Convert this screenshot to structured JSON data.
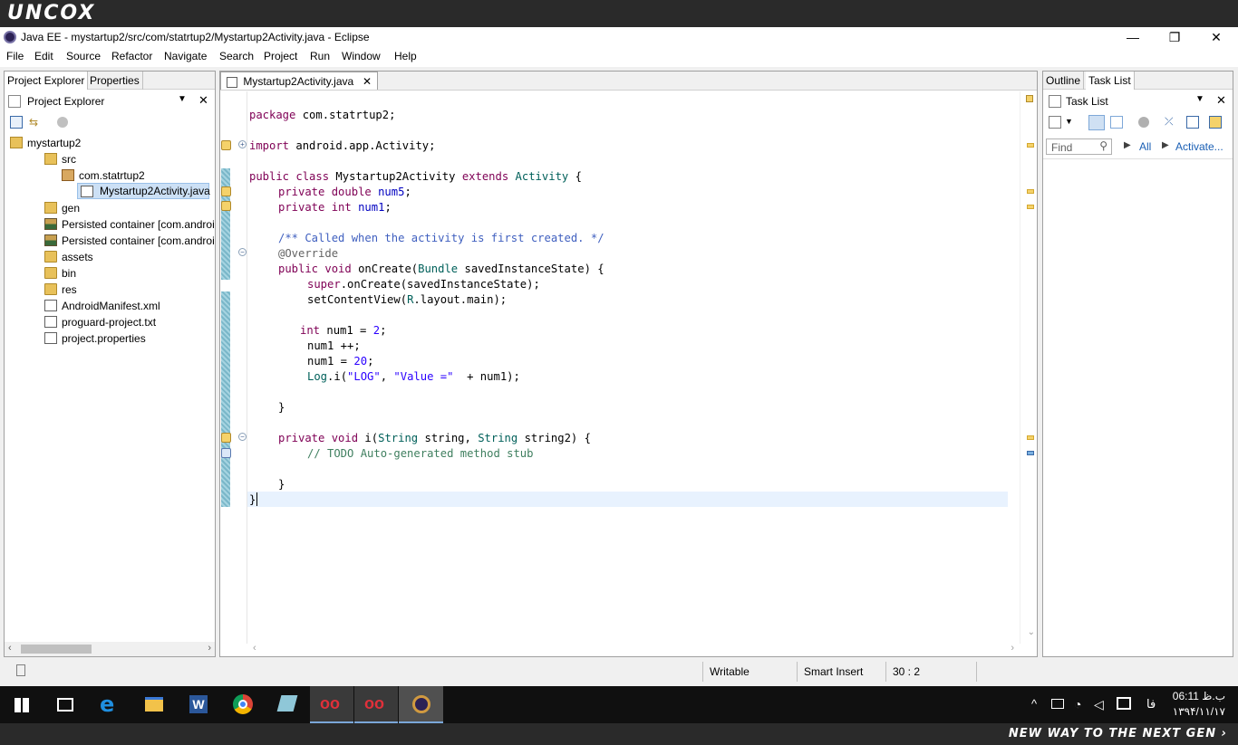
{
  "brand": {
    "top_logo": "UNCOX",
    "bottom_tagline": "NEW WAY TO THE NEXT GEN ›"
  },
  "window": {
    "title": "Java EE - mystartup2/src/com/statrtup2/Mystartup2Activity.java - Eclipse",
    "controls": {
      "minimize": "—",
      "maximize": "❐",
      "close": "✕"
    }
  },
  "menu": [
    "File",
    "Edit",
    "Source",
    "Refactor",
    "Navigate",
    "Search",
    "Project",
    "Run",
    "Window",
    "Help"
  ],
  "left_panel": {
    "tabs": [
      "Project Explorer",
      "Properties"
    ],
    "view_title": "Project Explorer",
    "tree": [
      {
        "label": "mystartup2"
      },
      {
        "label": "src"
      },
      {
        "label": "com.statrtup2"
      },
      {
        "label": "Mystartup2Activity.java"
      },
      {
        "label": "gen"
      },
      {
        "label": "Persisted container [com.androi"
      },
      {
        "label": "Persisted container [com.androi"
      },
      {
        "label": "assets"
      },
      {
        "label": "bin"
      },
      {
        "label": "res"
      },
      {
        "label": "AndroidManifest.xml"
      },
      {
        "label": "proguard-project.txt"
      },
      {
        "label": "project.properties"
      }
    ]
  },
  "editor": {
    "tab_label": "Mystartup2Activity.java",
    "close_glyph": "✕",
    "lines": [
      {
        "t": [
          [
            "kw",
            "package"
          ],
          [
            "",
            "com.statrtup2;"
          ]
        ]
      },
      {
        "t": [
          [
            "kw",
            "import"
          ],
          [
            "",
            "android.app.Activity;"
          ]
        ]
      },
      {
        "t": [
          [
            "kw",
            "public"
          ],
          [
            "",
            ""
          ],
          [
            "kw",
            "class"
          ],
          [
            "",
            "Mystartup2Activity"
          ],
          [
            "kw",
            "extends"
          ],
          [
            "ty",
            "Activity"
          ],
          [
            "",
            "{"
          ]
        ]
      },
      {
        "t": [
          [
            "kw",
            "private"
          ],
          [
            "kw",
            "double"
          ],
          [
            "fld",
            "num5"
          ],
          [
            "",
            ";"
          ]
        ]
      },
      {
        "t": [
          [
            "kw",
            "private"
          ],
          [
            "kw",
            "int"
          ],
          [
            "fld",
            "num1"
          ],
          [
            "",
            ";"
          ]
        ]
      },
      {
        "t": [
          [
            "cm",
            "/** Called when the activity is first created. */"
          ]
        ]
      },
      {
        "t": [
          [
            "ann",
            "@Override"
          ]
        ]
      },
      {
        "t": [
          [
            "kw",
            "public"
          ],
          [
            "kw",
            "void"
          ],
          [
            "",
            "onCreate("
          ],
          [
            "ty",
            "Bundle"
          ],
          [
            "",
            "savedInstanceState) {"
          ]
        ]
      },
      {
        "t": [
          [
            "kw",
            "super"
          ],
          [
            "",
            ".onCreate(savedInstanceState);"
          ]
        ]
      },
      {
        "t": [
          [
            "",
            "setContentView("
          ],
          [
            "ty",
            "R"
          ],
          [
            "",
            ".layout.main);"
          ]
        ]
      },
      {
        "t": [
          [
            "kw",
            "int"
          ],
          [
            "",
            "num1 = "
          ],
          [
            "num",
            "2"
          ],
          [
            "",
            ";"
          ]
        ]
      },
      {
        "t": [
          [
            "",
            "num1 ++;"
          ]
        ]
      },
      {
        "t": [
          [
            "",
            "num1 = "
          ],
          [
            "num",
            "20"
          ],
          [
            "",
            ";"
          ]
        ]
      },
      {
        "t": [
          [
            "ty",
            "Log"
          ],
          [
            "",
            ".i("
          ],
          [
            "str",
            "\"LOG\""
          ],
          [
            "",
            ", "
          ],
          [
            "str",
            "\"Value =\""
          ],
          [
            "",
            " + num1);"
          ]
        ]
      },
      {
        "t": [
          [
            "",
            "}"
          ]
        ]
      },
      {
        "t": [
          [
            "kw",
            "private"
          ],
          [
            "kw",
            "void"
          ],
          [
            "",
            "i("
          ],
          [
            "ty",
            "String"
          ],
          [
            "",
            "string, "
          ],
          [
            "ty",
            "String"
          ],
          [
            "",
            "string2) {"
          ]
        ]
      },
      {
        "t": [
          [
            "todo",
            "// TODO Auto-generated method stub"
          ]
        ]
      },
      {
        "t": [
          [
            "",
            "}"
          ]
        ]
      },
      {
        "t": [
          [
            "",
            "}"
          ]
        ]
      }
    ]
  },
  "right_panel": {
    "tabs": [
      "Outline",
      "Task List"
    ],
    "view_title": "Task List",
    "find_placeholder": "Find",
    "filter_all": "All",
    "activate_link": "Activate..."
  },
  "status": {
    "writable": "Writable",
    "insert_mode": "Smart Insert",
    "position": "30 : 2"
  },
  "taskbar": {
    "clock_time": "06:11 ب.ظ",
    "clock_date": "۱۳۹۴/۱۱/۱۷",
    "lang": "فا",
    "tray_up": "^"
  },
  "colors": {
    "keyword": "#7f0055",
    "string": "#2a00ff",
    "javadoc": "#3f5fbf",
    "todo": "#3f7f5f",
    "field": "#0000c0",
    "current_line": "#e8f2fe",
    "taskbar_active": "#7aa6d8"
  }
}
